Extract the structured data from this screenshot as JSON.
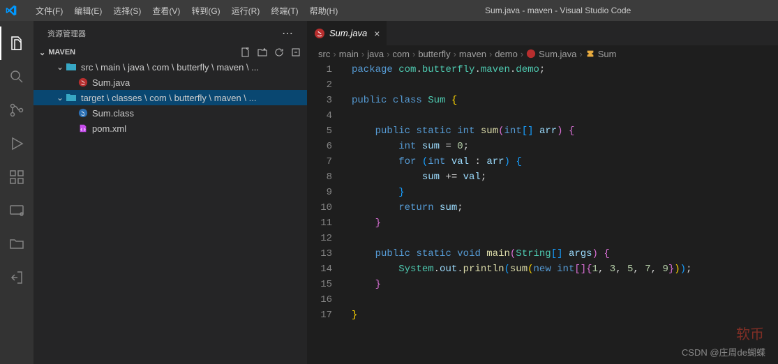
{
  "titleBar": {
    "menus": [
      "文件(F)",
      "编辑(E)",
      "选择(S)",
      "查看(V)",
      "转到(G)",
      "运行(R)",
      "终端(T)",
      "帮助(H)"
    ],
    "title": "Sum.java - maven - Visual Studio Code"
  },
  "sidebar": {
    "header": "资源管理器",
    "projectName": "MAVEN",
    "tree": [
      {
        "label": "src \\ main \\ java \\ com \\ butterfly \\ maven \\ ...",
        "type": "folder",
        "expanded": true,
        "indent": 1
      },
      {
        "label": "Sum.java",
        "type": "java",
        "indent": 2
      },
      {
        "label": "target \\ classes \\ com \\ butterfly \\ maven \\ ...",
        "type": "folder",
        "expanded": true,
        "indent": 1,
        "selected": true
      },
      {
        "label": "Sum.class",
        "type": "javaclass",
        "indent": 2
      },
      {
        "label": "pom.xml",
        "type": "xml",
        "indent": 2
      }
    ]
  },
  "tabs": [
    {
      "label": "Sum.java",
      "icon": "java",
      "active": true
    }
  ],
  "breadcrumbs": [
    "src",
    "main",
    "java",
    "com",
    "butterfly",
    "maven",
    "demo",
    "Sum.java",
    "Sum"
  ],
  "code": {
    "lines": [
      [
        {
          "t": "package",
          "c": "kw"
        },
        {
          "t": " ",
          "c": "punc"
        },
        {
          "t": "com",
          "c": "type"
        },
        {
          "t": ".",
          "c": "punc"
        },
        {
          "t": "butterfly",
          "c": "type"
        },
        {
          "t": ".",
          "c": "punc"
        },
        {
          "t": "maven",
          "c": "type"
        },
        {
          "t": ".",
          "c": "punc"
        },
        {
          "t": "demo",
          "c": "type"
        },
        {
          "t": ";",
          "c": "punc"
        }
      ],
      [],
      [
        {
          "t": "public",
          "c": "kw"
        },
        {
          "t": " ",
          "c": "punc"
        },
        {
          "t": "class",
          "c": "kw"
        },
        {
          "t": " ",
          "c": "punc"
        },
        {
          "t": "Sum",
          "c": "type"
        },
        {
          "t": " ",
          "c": "punc"
        },
        {
          "t": "{",
          "c": "brace-y"
        }
      ],
      [],
      [
        {
          "t": "    ",
          "c": "punc"
        },
        {
          "t": "public",
          "c": "kw"
        },
        {
          "t": " ",
          "c": "punc"
        },
        {
          "t": "static",
          "c": "kw"
        },
        {
          "t": " ",
          "c": "punc"
        },
        {
          "t": "int",
          "c": "kw"
        },
        {
          "t": " ",
          "c": "punc"
        },
        {
          "t": "sum",
          "c": "fn"
        },
        {
          "t": "(",
          "c": "brace-p"
        },
        {
          "t": "int",
          "c": "kw"
        },
        {
          "t": "[]",
          "c": "brace-b"
        },
        {
          "t": " ",
          "c": "punc"
        },
        {
          "t": "arr",
          "c": "var"
        },
        {
          "t": ")",
          "c": "brace-p"
        },
        {
          "t": " ",
          "c": "punc"
        },
        {
          "t": "{",
          "c": "brace-p"
        }
      ],
      [
        {
          "t": "        ",
          "c": "punc"
        },
        {
          "t": "int",
          "c": "kw"
        },
        {
          "t": " ",
          "c": "punc"
        },
        {
          "t": "sum",
          "c": "var"
        },
        {
          "t": " = ",
          "c": "punc"
        },
        {
          "t": "0",
          "c": "num"
        },
        {
          "t": ";",
          "c": "punc"
        }
      ],
      [
        {
          "t": "        ",
          "c": "punc"
        },
        {
          "t": "for",
          "c": "kw"
        },
        {
          "t": " ",
          "c": "punc"
        },
        {
          "t": "(",
          "c": "brace-b"
        },
        {
          "t": "int",
          "c": "kw"
        },
        {
          "t": " ",
          "c": "punc"
        },
        {
          "t": "val",
          "c": "var"
        },
        {
          "t": " : ",
          "c": "punc"
        },
        {
          "t": "arr",
          "c": "var"
        },
        {
          "t": ")",
          "c": "brace-b"
        },
        {
          "t": " ",
          "c": "punc"
        },
        {
          "t": "{",
          "c": "brace-b"
        }
      ],
      [
        {
          "t": "            ",
          "c": "punc"
        },
        {
          "t": "sum",
          "c": "var"
        },
        {
          "t": " += ",
          "c": "punc"
        },
        {
          "t": "val",
          "c": "var"
        },
        {
          "t": ";",
          "c": "punc"
        }
      ],
      [
        {
          "t": "        ",
          "c": "punc"
        },
        {
          "t": "}",
          "c": "brace-b"
        }
      ],
      [
        {
          "t": "        ",
          "c": "punc"
        },
        {
          "t": "return",
          "c": "kw"
        },
        {
          "t": " ",
          "c": "punc"
        },
        {
          "t": "sum",
          "c": "var"
        },
        {
          "t": ";",
          "c": "punc"
        }
      ],
      [
        {
          "t": "    ",
          "c": "punc"
        },
        {
          "t": "}",
          "c": "brace-p"
        }
      ],
      [],
      [
        {
          "t": "    ",
          "c": "punc"
        },
        {
          "t": "public",
          "c": "kw"
        },
        {
          "t": " ",
          "c": "punc"
        },
        {
          "t": "static",
          "c": "kw"
        },
        {
          "t": " ",
          "c": "punc"
        },
        {
          "t": "void",
          "c": "kw"
        },
        {
          "t": " ",
          "c": "punc"
        },
        {
          "t": "main",
          "c": "fn"
        },
        {
          "t": "(",
          "c": "brace-p"
        },
        {
          "t": "String",
          "c": "type"
        },
        {
          "t": "[]",
          "c": "brace-b"
        },
        {
          "t": " ",
          "c": "punc"
        },
        {
          "t": "args",
          "c": "var"
        },
        {
          "t": ")",
          "c": "brace-p"
        },
        {
          "t": " ",
          "c": "punc"
        },
        {
          "t": "{",
          "c": "brace-p"
        }
      ],
      [
        {
          "t": "        ",
          "c": "punc"
        },
        {
          "t": "System",
          "c": "type"
        },
        {
          "t": ".",
          "c": "punc"
        },
        {
          "t": "out",
          "c": "var"
        },
        {
          "t": ".",
          "c": "punc"
        },
        {
          "t": "println",
          "c": "fn"
        },
        {
          "t": "(",
          "c": "brace-b"
        },
        {
          "t": "sum",
          "c": "fn"
        },
        {
          "t": "(",
          "c": "brace-y"
        },
        {
          "t": "new",
          "c": "kw"
        },
        {
          "t": " ",
          "c": "punc"
        },
        {
          "t": "int",
          "c": "kw"
        },
        {
          "t": "[]",
          "c": "brace-p"
        },
        {
          "t": "{",
          "c": "brace-p"
        },
        {
          "t": "1",
          "c": "num"
        },
        {
          "t": ", ",
          "c": "punc"
        },
        {
          "t": "3",
          "c": "num"
        },
        {
          "t": ", ",
          "c": "punc"
        },
        {
          "t": "5",
          "c": "num"
        },
        {
          "t": ", ",
          "c": "punc"
        },
        {
          "t": "7",
          "c": "num"
        },
        {
          "t": ", ",
          "c": "punc"
        },
        {
          "t": "9",
          "c": "num"
        },
        {
          "t": "}",
          "c": "brace-p"
        },
        {
          "t": ")",
          "c": "brace-y"
        },
        {
          "t": ")",
          "c": "brace-b"
        },
        {
          "t": ";",
          "c": "punc"
        }
      ],
      [
        {
          "t": "    ",
          "c": "punc"
        },
        {
          "t": "}",
          "c": "brace-p"
        }
      ],
      [],
      [
        {
          "t": "}",
          "c": "brace-y"
        }
      ]
    ]
  },
  "watermark1": "软币",
  "watermark2": "CSDN @庄周de蝴蝶"
}
